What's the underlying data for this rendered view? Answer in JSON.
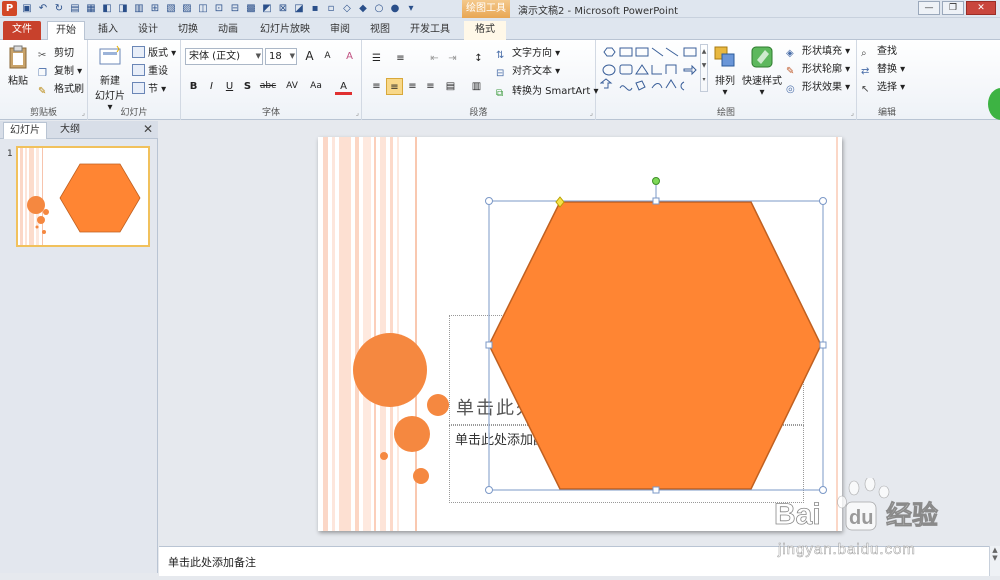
{
  "titlebar": {
    "app_icon": "P",
    "context_group": "绘图工具",
    "window_title": "演示文稿2 - Microsoft PowerPoint",
    "qat_icons": [
      "save-icon",
      "undo-icon",
      "redo-icon"
    ],
    "controls": [
      "—",
      "❐",
      "✕"
    ]
  },
  "tabs": [
    {
      "label": "文件",
      "state": "file"
    },
    {
      "label": "开始",
      "state": "active"
    },
    {
      "label": "插入"
    },
    {
      "label": "设计"
    },
    {
      "label": "切换"
    },
    {
      "label": "动画"
    },
    {
      "label": "幻灯片放映"
    },
    {
      "label": "审阅"
    },
    {
      "label": "视图"
    },
    {
      "label": "开发工具"
    },
    {
      "label": "格式",
      "state": "format"
    }
  ],
  "ribbon": {
    "help": "△ ?",
    "clipboard": {
      "label": "剪贴板",
      "paste": "粘贴",
      "cut": "剪切",
      "copy": "复制",
      "format_painter": "格式刷"
    },
    "slides": {
      "label": "幻灯片",
      "new_slide": "新建",
      "new_slide_2": "幻灯片",
      "layout": "版式",
      "reset": "重设",
      "section": "节"
    },
    "font": {
      "label": "字体",
      "font_name": "宋体 (正文)",
      "font_size": "18",
      "grow": "A",
      "shrink": "A",
      "clear": "A",
      "bold": "B",
      "italic": "I",
      "underline": "U",
      "shadow": "S",
      "strike": "abc",
      "spacing": "AV",
      "case": "Aa",
      "color": "A"
    },
    "paragraph": {
      "label": "段落",
      "text_direction": "文字方向",
      "align_text": "对齐文本",
      "smartart": "转换为 SmartArt"
    },
    "drawing": {
      "label": "绘图",
      "arrange": "排列",
      "quick_styles": "快速样式",
      "fill": "形状填充",
      "outline": "形状轮廓",
      "effects": "形状效果"
    },
    "editing": {
      "label": "编辑",
      "find": "查找",
      "replace": "替换",
      "select": "选择"
    }
  },
  "left_panel": {
    "tabs": [
      "幻灯片",
      "大纲"
    ],
    "close": "✕",
    "slide_number": "1"
  },
  "slide": {
    "title_placeholder": "单击此处添加标题",
    "subtitle_placeholder": "单击此处添加副标题",
    "hexagon_color": "#ff8533",
    "hexagon_stroke": "#c06020",
    "circle_color": "#f58840"
  },
  "notes": {
    "placeholder": "单击此处添加备注"
  },
  "watermark": {
    "brand": "Bai",
    "brand_tail": "du",
    "sub": "经验",
    "url": "jingyan.baidu.com"
  }
}
